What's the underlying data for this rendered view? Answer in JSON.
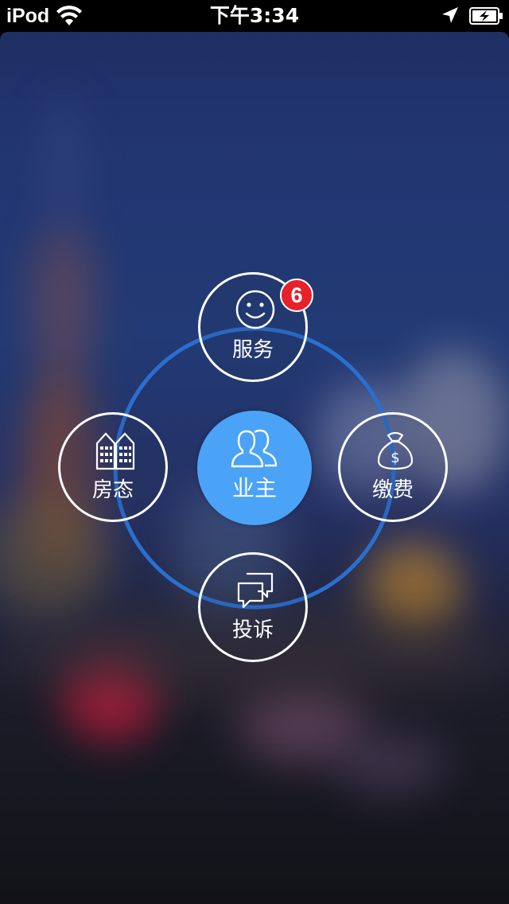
{
  "status_bar": {
    "carrier": "iPod",
    "time": "下午3:34",
    "icons": [
      "wifi-icon",
      "location-arrow-icon",
      "battery-charging-icon"
    ]
  },
  "menu": {
    "center": {
      "label": "业主",
      "icon": "users-icon",
      "color": "#4aa3f7"
    },
    "top": {
      "label": "服务",
      "icon": "smiley-icon",
      "badge": "6"
    },
    "left": {
      "label": "房态",
      "icon": "buildings-icon"
    },
    "right": {
      "label": "缴费",
      "icon": "money-bag-icon"
    },
    "bottom": {
      "label": "投诉",
      "icon": "chat-bubbles-icon"
    }
  },
  "colors": {
    "ring": "#2a6fd0",
    "badge": "#e8202a",
    "node_border": "#ffffff"
  }
}
